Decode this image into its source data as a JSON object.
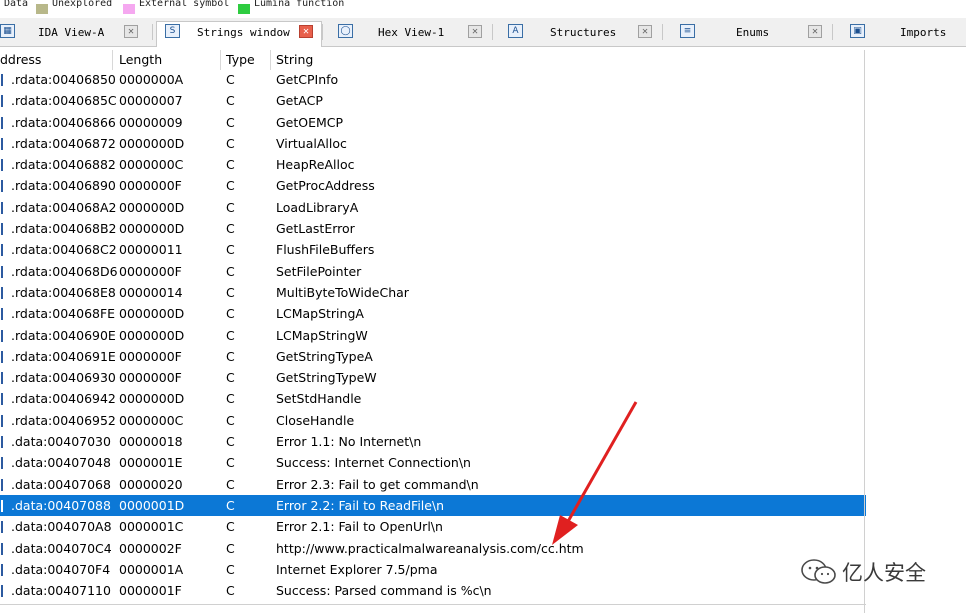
{
  "legend": {
    "items": [
      {
        "label": "Data",
        "color": "#b8b88a"
      },
      {
        "label": "Unexplored",
        "color": "#f5a8f0"
      },
      {
        "label": "External symbol",
        "color": "#2ecc40"
      },
      {
        "label": "Lumina function"
      }
    ]
  },
  "tabs": [
    {
      "label": "IDA View-A",
      "icon": "ida-view-icon",
      "active": false
    },
    {
      "label": "Strings window",
      "icon": "strings-icon",
      "active": true
    },
    {
      "label": "Hex View-1",
      "icon": "hex-view-icon",
      "active": false
    },
    {
      "label": "Structures",
      "icon": "structures-icon",
      "active": false
    },
    {
      "label": "Enums",
      "icon": "enums-icon",
      "active": false
    },
    {
      "label": "Imports",
      "icon": "imports-icon",
      "active": false
    }
  ],
  "table": {
    "headers": {
      "address": "ddress",
      "length": "Length",
      "type": "Type",
      "string": "String"
    },
    "rows": [
      {
        "address": ".rdata:00406850",
        "length": "0000000A",
        "type": "C",
        "string": "GetCPInfo"
      },
      {
        "address": ".rdata:0040685C",
        "length": "00000007",
        "type": "C",
        "string": "GetACP"
      },
      {
        "address": ".rdata:00406866",
        "length": "00000009",
        "type": "C",
        "string": "GetOEMCP"
      },
      {
        "address": ".rdata:00406872",
        "length": "0000000D",
        "type": "C",
        "string": "VirtualAlloc"
      },
      {
        "address": ".rdata:00406882",
        "length": "0000000C",
        "type": "C",
        "string": "HeapReAlloc"
      },
      {
        "address": ".rdata:00406890",
        "length": "0000000F",
        "type": "C",
        "string": "GetProcAddress"
      },
      {
        "address": ".rdata:004068A2",
        "length": "0000000D",
        "type": "C",
        "string": "LoadLibraryA"
      },
      {
        "address": ".rdata:004068B2",
        "length": "0000000D",
        "type": "C",
        "string": "GetLastError"
      },
      {
        "address": ".rdata:004068C2",
        "length": "00000011",
        "type": "C",
        "string": "FlushFileBuffers"
      },
      {
        "address": ".rdata:004068D6",
        "length": "0000000F",
        "type": "C",
        "string": "SetFilePointer"
      },
      {
        "address": ".rdata:004068E8",
        "length": "00000014",
        "type": "C",
        "string": "MultiByteToWideChar"
      },
      {
        "address": ".rdata:004068FE",
        "length": "0000000D",
        "type": "C",
        "string": "LCMapStringA"
      },
      {
        "address": ".rdata:0040690E",
        "length": "0000000D",
        "type": "C",
        "string": "LCMapStringW"
      },
      {
        "address": ".rdata:0040691E",
        "length": "0000000F",
        "type": "C",
        "string": "GetStringTypeA"
      },
      {
        "address": ".rdata:00406930",
        "length": "0000000F",
        "type": "C",
        "string": "GetStringTypeW"
      },
      {
        "address": ".rdata:00406942",
        "length": "0000000D",
        "type": "C",
        "string": "SetStdHandle"
      },
      {
        "address": ".rdata:00406952",
        "length": "0000000C",
        "type": "C",
        "string": "CloseHandle"
      },
      {
        "address": ".data:00407030",
        "length": "00000018",
        "type": "C",
        "string": "Error 1.1: No Internet\\n"
      },
      {
        "address": ".data:00407048",
        "length": "0000001E",
        "type": "C",
        "string": "Success: Internet Connection\\n"
      },
      {
        "address": ".data:00407068",
        "length": "00000020",
        "type": "C",
        "string": "Error 2.3: Fail to get command\\n"
      },
      {
        "address": ".data:00407088",
        "length": "0000001D",
        "type": "C",
        "string": "Error 2.2: Fail to ReadFile\\n",
        "selected": true
      },
      {
        "address": ".data:004070A8",
        "length": "0000001C",
        "type": "C",
        "string": "Error 2.1: Fail to OpenUrl\\n"
      },
      {
        "address": ".data:004070C4",
        "length": "0000002F",
        "type": "C",
        "string": "http://www.practicalmalwareanalysis.com/cc.htm"
      },
      {
        "address": ".data:004070F4",
        "length": "0000001A",
        "type": "C",
        "string": "Internet Explorer 7.5/pma"
      },
      {
        "address": ".data:00407110",
        "length": "0000001F",
        "type": "C",
        "string": "Success: Parsed command is %c\\n"
      }
    ]
  },
  "annotation": {
    "arrow_color": "#e02020"
  },
  "watermark": {
    "text": "亿人安全",
    "icon": "wechat-logo-icon"
  }
}
